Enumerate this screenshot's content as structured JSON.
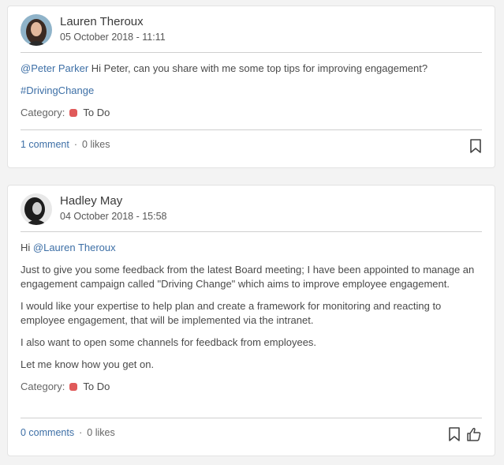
{
  "posts": [
    {
      "author": "Lauren Theroux",
      "date": "05 October 2018 - 11:11",
      "mention": "@Peter Parker",
      "message": " Hi Peter, can you share with me some top tips for improving engagement?",
      "hashtag": "#DrivingChange",
      "category_label": "Category:",
      "category_value": "To Do",
      "comments": "1 comment",
      "likes": "0 likes"
    },
    {
      "author": "Hadley May",
      "date": "04 October 2018 - 15:58",
      "greeting": "Hi ",
      "mention": "@Lauren Theroux",
      "paragraphs": [
        "Just to give you some feedback from the latest Board meeting; I have been appointed to manage an engagement campaign called \"Driving Change\" which aims to improve employee engagement.",
        "I would like your expertise to help plan and create a framework for monitoring and reacting to employee engagement, that will be implemented via the intranet.",
        "I also want to open some channels for feedback from employees.",
        "Let me know how you get on."
      ],
      "category_label": "Category:",
      "category_value": "To Do",
      "comments": "0 comments",
      "likes": "0 likes"
    }
  ],
  "colors": {
    "link": "#3d6fa6",
    "category_dot": "#e05a5a"
  },
  "icons": [
    "bookmark-icon",
    "thumbs-up-icon"
  ]
}
